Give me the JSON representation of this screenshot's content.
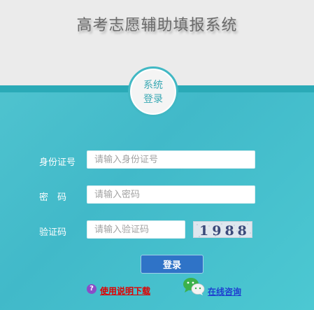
{
  "header": {
    "title": "高考志愿辅助填报系统"
  },
  "badge": {
    "line1": "系统",
    "line2": "登录"
  },
  "form": {
    "id_label": "身份证号",
    "id_placeholder": "请输入身份证号",
    "password_label": "密　码",
    "password_placeholder": "请输入密码",
    "captcha_label": "验证码",
    "captcha_placeholder": "请输入验证码",
    "captcha_text": "1988",
    "login_label": "登录"
  },
  "footer": {
    "help_icon": "question-icon",
    "help_text": "使用说明下载",
    "chat_icon": "wechat-icon",
    "consult_text": "在线咨询"
  },
  "colors": {
    "panel": "#41b9c9",
    "band": "#2aaab7",
    "button": "#2f73c7",
    "help_link": "#e00000",
    "consult_link": "#1f3fd0"
  }
}
